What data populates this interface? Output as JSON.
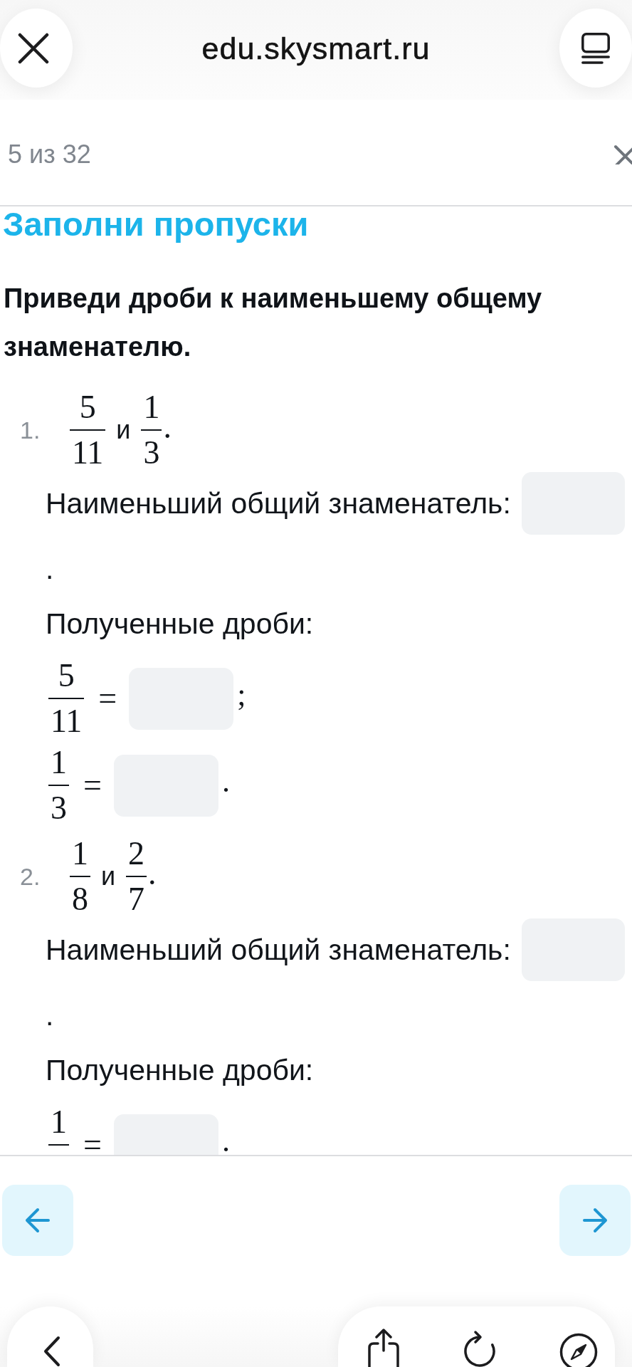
{
  "browser_bar": {
    "url": "edu.skysmart.ru"
  },
  "task_header": {
    "progress": "5 из 32"
  },
  "task": {
    "title": "Заполни пропуски",
    "instruction": "Приведи дроби к наименьшему общему знаменателю.",
    "exercises": [
      {
        "number": "1.",
        "expression": [
          {
            "kind": "fraction",
            "numerator": "5",
            "denominator": "11"
          },
          {
            "kind": "text",
            "text": "и"
          },
          {
            "kind": "fraction",
            "numerator": "1",
            "denominator": "3"
          },
          {
            "kind": "punctuation",
            "text": "."
          }
        ],
        "lcd_label": "Наименьший общий знаменатель:",
        "lcd_end": ".",
        "results_label": "Полученные дроби:",
        "results": [
          {
            "numerator": "5",
            "denominator": "11",
            "sign": "=",
            "end": ";"
          },
          {
            "numerator": "1",
            "denominator": "3",
            "sign": "=",
            "end": "."
          }
        ]
      },
      {
        "number": "2.",
        "expression": [
          {
            "kind": "fraction",
            "numerator": "1",
            "denominator": "8"
          },
          {
            "kind": "text",
            "text": "и"
          },
          {
            "kind": "fraction",
            "numerator": "2",
            "denominator": "7"
          },
          {
            "kind": "punctuation",
            "text": "."
          }
        ],
        "lcd_label": "Наименьший общий знаменатель:",
        "lcd_end": ".",
        "results_label": "Полученные дроби:",
        "results": [
          {
            "numerator": "1",
            "sign": "=",
            "end": "."
          }
        ]
      }
    ]
  }
}
